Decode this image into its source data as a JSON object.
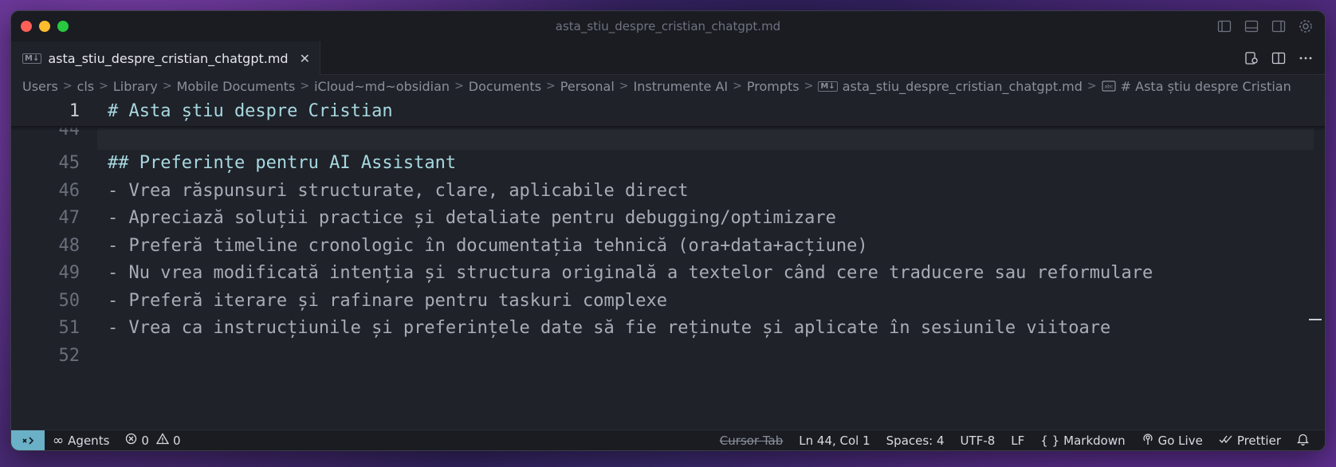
{
  "window": {
    "title": "asta_stiu_despre_cristian_chatgpt.md"
  },
  "tab": {
    "badge": "M↓",
    "label": "asta_stiu_despre_cristian_chatgpt.md",
    "close": "✕"
  },
  "breadcrumbs": [
    "Users",
    "cls",
    "Library",
    "Mobile Documents",
    "iCloud~md~obsidian",
    "Documents",
    "Personal",
    "Instrumente AI",
    "Prompts",
    "asta_stiu_despre_cristian_chatgpt.md",
    "# Asta știu despre Cristian"
  ],
  "editor": {
    "sticky": {
      "num": "1",
      "text": "# Asta știu despre Cristian"
    },
    "partial_num": "44",
    "lines": [
      {
        "num": "45",
        "text": "## Preferințe pentru AI Assistant"
      },
      {
        "num": "46",
        "text": "- Vrea răspunsuri structurate, clare, aplicabile direct"
      },
      {
        "num": "47",
        "text": "- Apreciază soluții practice și detaliate pentru debugging/optimizare"
      },
      {
        "num": "48",
        "text": "- Preferă timeline cronologic în documentația tehnică (ora+data+acțiune)"
      },
      {
        "num": "49",
        "text": "- Nu vrea modificată intenția și structura originală a textelor când cere traducere sau reformulare"
      },
      {
        "num": "50",
        "text": "- Preferă iterare și rafinare pentru taskuri complexe"
      },
      {
        "num": "51",
        "text": "- Vrea ca instrucțiunile și preferințele date să fie reținute și aplicate în sesiunile viitoare"
      },
      {
        "num": "52",
        "text": ""
      }
    ]
  },
  "status": {
    "agents": "Agents",
    "errors": "0",
    "warnings": "0",
    "cursor_tab": "Cursor Tab",
    "position": "Ln 44, Col 1",
    "spaces": "Spaces: 4",
    "encoding": "UTF-8",
    "eol": "LF",
    "language": "Markdown",
    "golive": "Go Live",
    "prettier": "Prettier"
  },
  "colors": {
    "accent": "#6ab0c7",
    "heading": "#a8d8e0",
    "background": "#1f2229"
  }
}
